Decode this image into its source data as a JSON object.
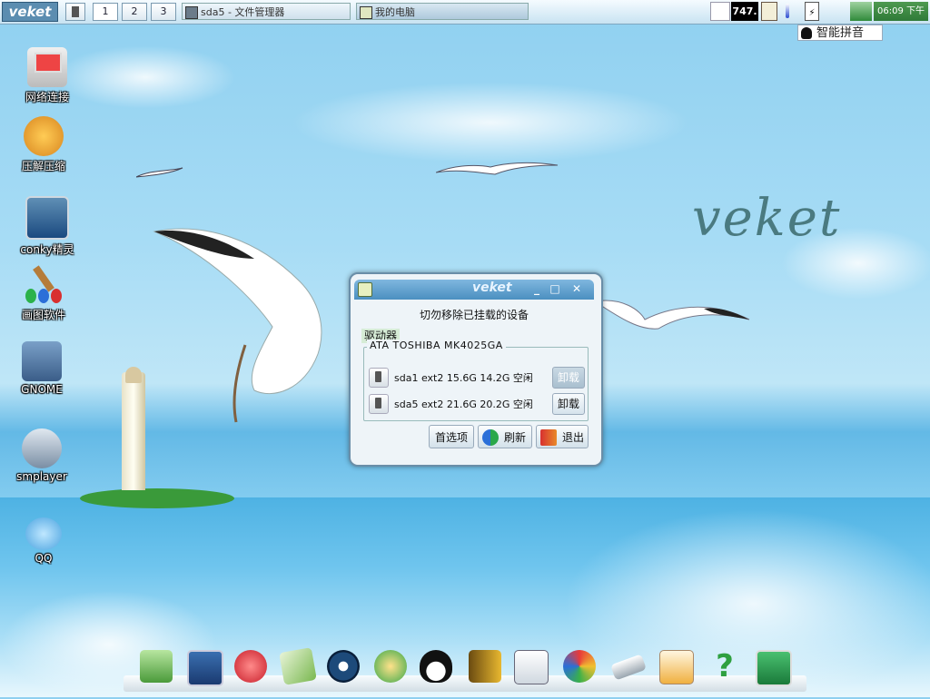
{
  "top_panel": {
    "logo": "veket",
    "workspaces": [
      "1",
      "2",
      "3"
    ],
    "tasks": [
      {
        "label": "sda5 - 文件管理器"
      },
      {
        "label": "我的电脑"
      }
    ],
    "tray": {
      "counter": "747.",
      "time": "06:09",
      "ampm": "下午"
    }
  },
  "ime_indicator": {
    "label": "智能拼音"
  },
  "desktop_icons": [
    {
      "label": "网络连接",
      "icon": "network-icon"
    },
    {
      "label": "压解压缩",
      "icon": "archive-icon"
    },
    {
      "label": "conky精灵",
      "icon": "conky-icon"
    },
    {
      "label": "画图软件",
      "icon": "paint-icon"
    },
    {
      "label": "GNOME",
      "icon": "gnome-icon"
    },
    {
      "label": "smplayer",
      "icon": "smplayer-icon"
    },
    {
      "label": "QQ",
      "icon": "qq-icon"
    }
  ],
  "wallpaper_text": "veket",
  "dialog": {
    "title": "veket",
    "heading": "切勿移除已挂载的设备",
    "section_label": "驱动器",
    "drive_name": "ATA TOSHIBA MK4025GA",
    "partitions": [
      {
        "text": "sda1 ext2 15.6G 14.2G 空闲",
        "unmount_label": "卸载",
        "disabled": true
      },
      {
        "text": "sda5 ext2 21.6G 20.2G 空闲",
        "unmount_label": "卸载",
        "disabled": false
      }
    ],
    "buttons": {
      "prefs": "首选项",
      "refresh": "刷新",
      "quit": "退出"
    }
  },
  "dock_items": [
    "folder-icon",
    "monitor-icon",
    "hedgehog-icon",
    "notepad-icon",
    "music-player-icon",
    "users-icon",
    "penguin-icon",
    "book-icon",
    "chart-icon",
    "palette-icon",
    "usb-drive-icon",
    "calendar-icon",
    "help-icon",
    "camera-icon"
  ],
  "colors": {
    "sky": "#a7dcf5",
    "sea": "#4eb2e3",
    "titlebar": "#4b8fc0",
    "island": "#3a9a3a"
  }
}
